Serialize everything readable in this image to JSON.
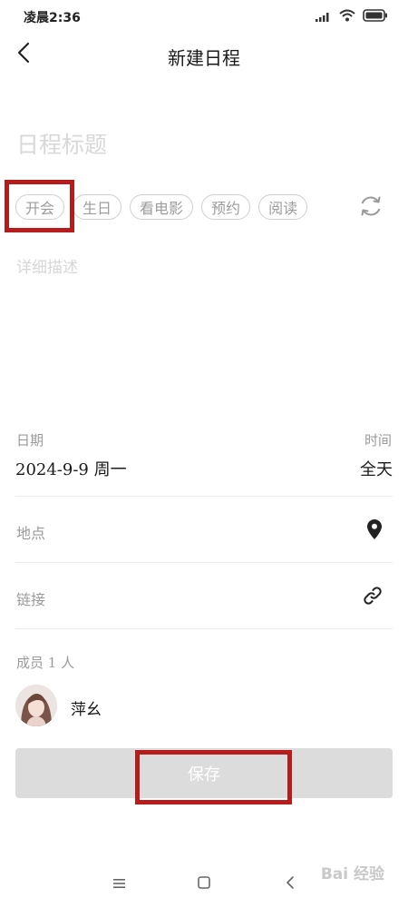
{
  "status_bar": {
    "time": "凌晨2:36"
  },
  "header": {
    "title": "新建日程",
    "back_icon": "chevron-left-icon"
  },
  "form": {
    "title_placeholder": "日程标题",
    "tags": [
      "开会",
      "生日",
      "看电影",
      "预约",
      "阅读"
    ],
    "description_placeholder": "详细描述"
  },
  "schedule": {
    "date_label": "日期",
    "date_value": "2024-9-9 周一",
    "time_label": "时间",
    "time_value": "全天"
  },
  "location": {
    "label": "地点",
    "icon": "location-pin-icon"
  },
  "link": {
    "label": "链接",
    "icon": "link-icon"
  },
  "members": {
    "label": "成员 1 人",
    "name": "萍幺"
  },
  "actions": {
    "save_label": "保存"
  },
  "watermark": "Bai 经验",
  "colors": {
    "highlight": "#b71c1c",
    "save_bg": "#dcdcdc",
    "placeholder": "#d8d8d8"
  }
}
